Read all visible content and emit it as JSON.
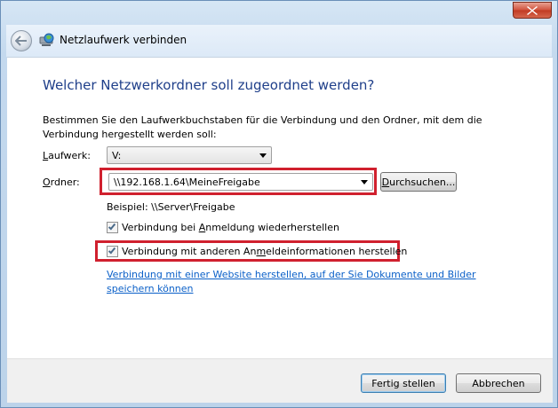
{
  "window": {
    "title": "Netzlaufwerk verbinden"
  },
  "page": {
    "heading": "Welcher Netzwerkordner soll zugeordnet werden?",
    "description": "Bestimmen Sie den Laufwerkbuchstaben für die Verbindung und den Ordner, mit dem die Verbindung hergestellt werden soll:"
  },
  "drive": {
    "label_pre": "",
    "label_accel": "L",
    "label_post": "aufwerk:",
    "value": "V:"
  },
  "folder": {
    "label_pre": "",
    "label_accel": "O",
    "label_post": "rdner:",
    "value": "\\\\192.168.1.64\\MeineFreigabe",
    "browse_pre": "",
    "browse_accel": "D",
    "browse_post": "urchsuchen..."
  },
  "example": "Beispiel: \\\\Server\\Freigabe",
  "reconnect": {
    "checked": true,
    "label_pre": "Verbindung bei ",
    "label_accel": "A",
    "label_post": "nmeldung wiederherstellen"
  },
  "credentials": {
    "checked": true,
    "label_pre": "Verbindung mit anderen An",
    "label_accel": "m",
    "label_post": "eldeinformationen herstellen"
  },
  "website_link": "Verbindung mit einer Website herstellen, auf der Sie Dokumente und Bilder speichern können",
  "buttons": {
    "finish": "Fertig stellen",
    "cancel": "Abbrechen"
  },
  "colors": {
    "heading": "#1f3f8a",
    "link": "#0b60c8",
    "highlight": "#d0202e"
  }
}
